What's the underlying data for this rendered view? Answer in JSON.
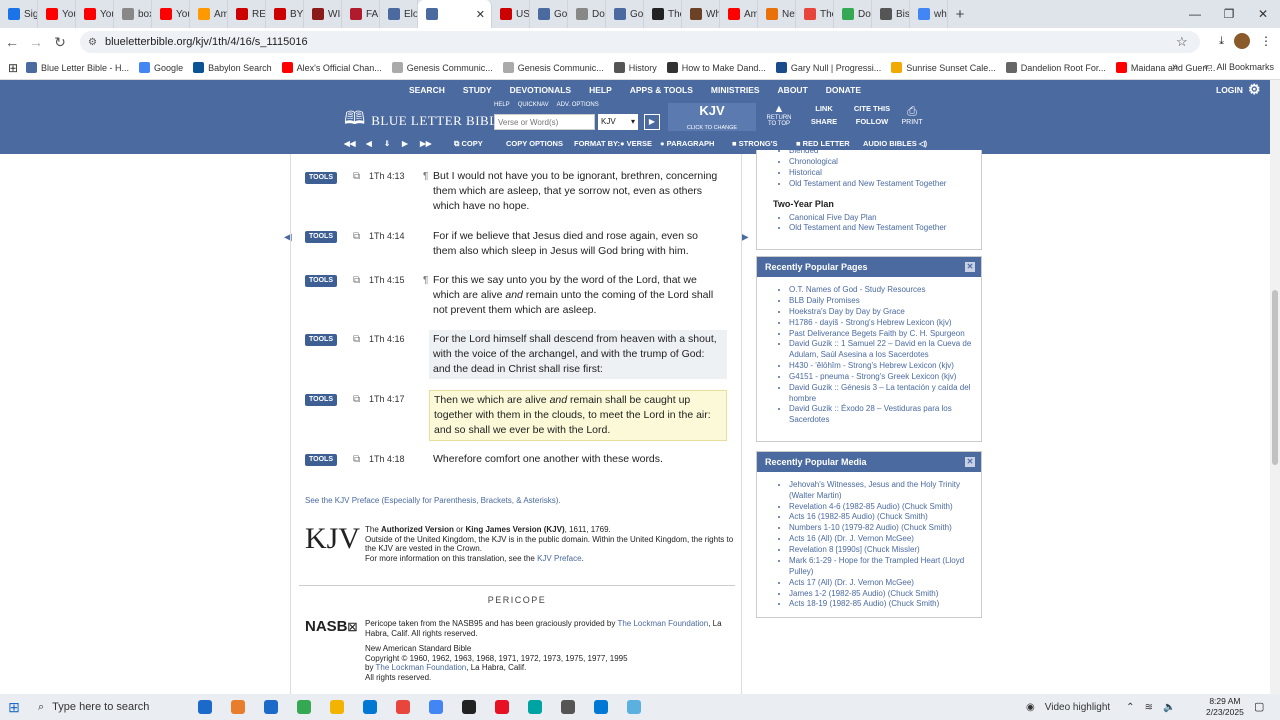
{
  "browser": {
    "tabs": [
      {
        "label": "Sign",
        "color": "#1a73e8"
      },
      {
        "label": "You",
        "color": "#ff0000"
      },
      {
        "label": "You",
        "color": "#ff0000"
      },
      {
        "label": "boxi",
        "color": "#888888"
      },
      {
        "label": "You",
        "color": "#ff0000"
      },
      {
        "label": "Am",
        "color": "#ff9900"
      },
      {
        "label": "RES",
        "color": "#cc0000"
      },
      {
        "label": "BYD",
        "color": "#cc0000"
      },
      {
        "label": "WIS",
        "color": "#8b1a1a"
      },
      {
        "label": "FAM",
        "color": "#b01c2e"
      },
      {
        "label": "Elon",
        "color": "#4a6aa0"
      },
      {
        "label": "",
        "color": "#4a6aa0",
        "active": true
      },
      {
        "label": "USA",
        "color": "#cc0000"
      },
      {
        "label": "Goi",
        "color": "#4a6aa0"
      },
      {
        "label": "Dor",
        "color": "#888888"
      },
      {
        "label": "Goi",
        "color": "#4a6aa0"
      },
      {
        "label": "The",
        "color": "#222222"
      },
      {
        "label": "Wh",
        "color": "#6b4226"
      },
      {
        "label": "Am",
        "color": "#ff0000"
      },
      {
        "label": "New",
        "color": "#e8710a"
      },
      {
        "label": "The",
        "color": "#e8453c"
      },
      {
        "label": "Doll",
        "color": "#34a853"
      },
      {
        "label": "Bish",
        "color": "#555555"
      },
      {
        "label": "who",
        "color": "#4285f4"
      }
    ],
    "active_tab_close": "✕",
    "new_tab": "+",
    "window_controls": [
      "—",
      "❐",
      "✕"
    ],
    "url": "blueletterbible.org/kjv/1th/4/16/s_1115016",
    "bookmarks": [
      {
        "label": "Blue Letter Bible - H...",
        "color": "#4a6aa0"
      },
      {
        "label": "Google",
        "color": "#4285f4"
      },
      {
        "label": "Babylon Search",
        "color": "#0b5394"
      },
      {
        "label": "Alex's Official Chan...",
        "color": "#ff0000"
      },
      {
        "label": "Genesis Communic...",
        "color": "#aaaaaa"
      },
      {
        "label": "Genesis Communic...",
        "color": "#aaaaaa"
      },
      {
        "label": "History",
        "color": "#555555"
      },
      {
        "label": "How to Make Dand...",
        "color": "#333333"
      },
      {
        "label": "Gary Null | Progressi...",
        "color": "#1a4c8b"
      },
      {
        "label": "Sunrise Sunset Cale...",
        "color": "#f2a900"
      },
      {
        "label": "Dandelion Root For...",
        "color": "#666666"
      },
      {
        "label": "Maidana and Guerr...",
        "color": "#ff0000"
      }
    ],
    "bookmarks_more": "»",
    "all_bookmarks": "All Bookmarks"
  },
  "blb": {
    "nav": [
      "SEARCH",
      "STUDY",
      "DEVOTIONALS",
      "HELP",
      "APPS & TOOLS",
      "MINISTRIES",
      "ABOUT",
      "DONATE"
    ],
    "login": "LOGIN",
    "logo_text": "BLUE LETTER BIBLE",
    "search_labels": [
      "HELP",
      "QUICKNAV",
      "ADV. OPTIONS"
    ],
    "search_placeholder": "Verse or Word(s)",
    "version": "KJV",
    "version_box": "KJV",
    "version_sub": "CLICK TO CHANGE",
    "return_top": "RETURN TO TOP",
    "header_buttons": [
      "LINK",
      "CITE THIS",
      "SHARE",
      "FOLLOW"
    ],
    "print": "PRINT",
    "toolbar": {
      "copy": "COPY",
      "copy_options": "COPY OPTIONS",
      "format_by": "FORMAT BY:",
      "verse": "VERSE",
      "paragraph": "PARAGRAPH",
      "strongs": "STRONG'S",
      "red_letter": "RED LETTER",
      "audio": "AUDIO BIBLES"
    }
  },
  "verses": [
    {
      "tools": "TOOLS",
      "ref": "1Th 4:13",
      "pilcrow": "¶",
      "text": "But I would not have you to be ignorant, brethren, concerning them which are asleep, that ye sorrow not, even as others which have no hope."
    },
    {
      "tools": "TOOLS",
      "ref": "1Th 4:14",
      "pilcrow": "",
      "text": "For if we believe that Jesus died and rose again, even so them also which sleep in Jesus will God bring with him."
    },
    {
      "tools": "TOOLS",
      "ref": "1Th 4:15",
      "pilcrow": "¶",
      "text_a": "For this we say unto you by the word of the Lord, that we which are alive ",
      "text_i": "and",
      "text_b": " remain unto the coming of the Lord shall not prevent them which are asleep."
    },
    {
      "tools": "TOOLS",
      "ref": "1Th 4:16",
      "pilcrow": "",
      "text": "For the Lord himself shall descend from heaven with a shout, with the voice of the archangel, and with the trump of God: and the dead in Christ shall rise first:"
    },
    {
      "tools": "TOOLS",
      "ref": "1Th 4:17",
      "pilcrow": "",
      "text_a": "Then we which are alive ",
      "text_i": "and",
      "text_b": " remain shall be caught up together with them in the clouds, to meet the Lord in the air: and so shall we ever be with the Lord."
    },
    {
      "tools": "TOOLS",
      "ref": "1Th 4:18",
      "pilcrow": "",
      "text": "Wherefore comfort one another with these words."
    }
  ],
  "preface_link": "See the KJV Preface (Especially for Parenthesis, Brackets, & Asterisks).",
  "kjv_block": {
    "logo": "KJV",
    "p1_pre": "The ",
    "p1_b1": "Authorized Version",
    "p1_mid": " or ",
    "p1_b2": "King James Version (KJV)",
    "p1_post": ", 1611, 1769.",
    "p2": "Outside of the United Kingdom, the KJV is in the public domain. Within the United Kingdom, the rights to the KJV are vested in the Crown.",
    "p3_pre": "For more information on this translation, see the ",
    "p3_link": "KJV Preface",
    "p3_post": "."
  },
  "pericope": {
    "title": "PERICOPE",
    "logo": "NASB",
    "p1_pre": "Pericope taken from the NASB95 and has been graciously provided by ",
    "p1_link": "The Lockman Foundation",
    "p1_post": ", La Habra, Calif. All rights reserved.",
    "p2": "New American Standard Bible",
    "p3": "Copyright © 1960, 1962, 1963, 1968, 1971, 1972, 1973, 1975, 1977, 1995",
    "p4_pre": "by ",
    "p4_link": "The Lockman Foundation",
    "p4_post": ", La Habra, Calif.",
    "p5": "All rights reserved."
  },
  "sidebar": {
    "plans_top": [
      "Blended",
      "Chronological",
      "Historical",
      "Old Testament and New Testament Together"
    ],
    "two_year_title": "Two-Year Plan",
    "two_year": [
      "Canonical Five Day Plan",
      "Old Testament and New Testament Together"
    ],
    "popular_pages_title": "Recently Popular Pages",
    "popular_pages": [
      "O.T. Names of God - Study Resources",
      "BLB Daily Promises",
      "Hoekstra's Day by Day by Grace",
      "H1786 - dayiš - Strong's Hebrew Lexicon (kjv)",
      "Past Deliverance Begets Faith by C. H. Spurgeon",
      "David Guzik :: 1 Samuel 22 – David en la Cueva de Adulam, Saúl Asesina a los Sacerdotes",
      "H430 - 'ĕlōhîm - Strong's Hebrew Lexicon (kjv)",
      "G4151 - pneuma - Strong's Greek Lexicon (kjv)",
      "David Guzik :: Génesis 3 – La tentación y caída del hombre",
      "David Guzik :: Éxodo 28 – Vestiduras para los Sacerdotes"
    ],
    "popular_media_title": "Recently Popular Media",
    "popular_media": [
      "Jehovah's Witnesses, Jesus and the Holy Trinity (Walter Martin)",
      "Revelation 4-6 (1982-85 Audio) (Chuck Smith)",
      "Acts 16 (1982-85 Audio) (Chuck Smith)",
      "Numbers 1-10 (1979-82 Audio) (Chuck Smith)",
      "Acts 16 (All) (Dr. J. Vernon McGee)",
      "Revelation 8 [1990s] (Chuck Missler)",
      "Mark 6:1-29 - Hope for the Trampled Heart (Lloyd Pulley)",
      "Acts 17 (All) (Dr. J. Vernon McGee)",
      "James 1-2 (1982-85 Audio) (Chuck Smith)",
      "Acts 18-19 (1982-85 Audio) (Chuck Smith)"
    ],
    "close": "✕"
  },
  "taskbar": {
    "search_placeholder": "Type here to search",
    "video_highlight": "Video highlight",
    "time": "8:29 AM",
    "date": "2/23/2025",
    "apps": [
      "#1b6ac9",
      "#e87d2c",
      "#1b6ac9",
      "#34a853",
      "#f2b400",
      "#0078d4",
      "#e8453c",
      "#4285f4",
      "#222222",
      "#e81123",
      "#00a3a3",
      "#555555",
      "#0078d4",
      "#5bb0e0"
    ]
  }
}
